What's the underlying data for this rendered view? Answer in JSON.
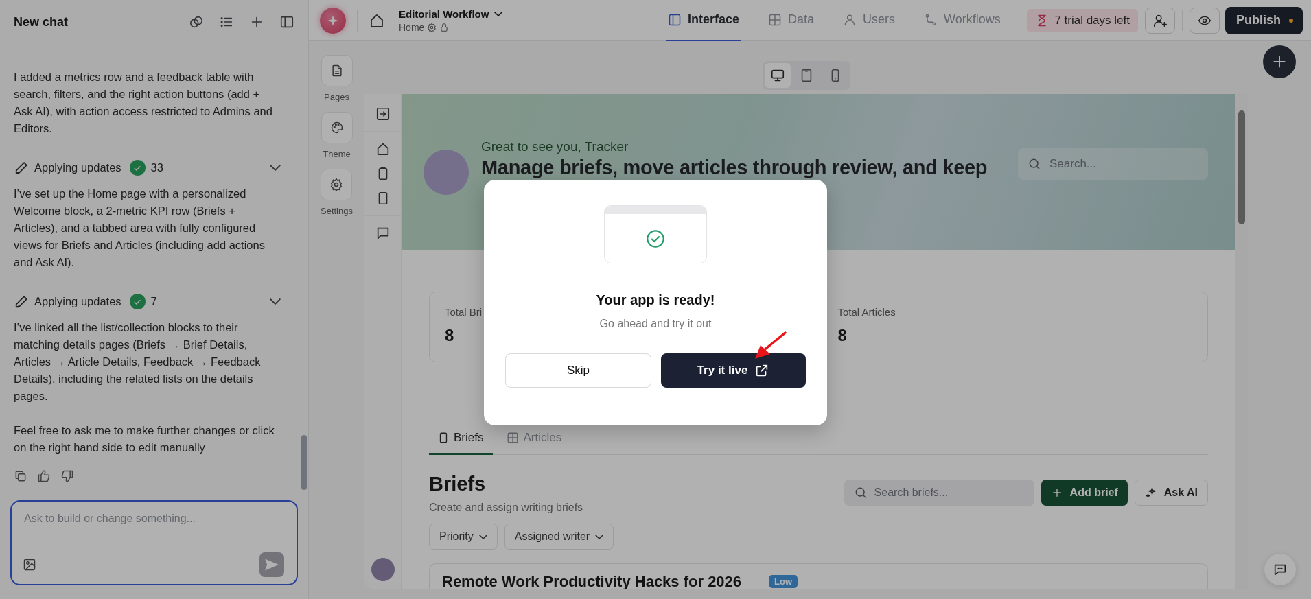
{
  "chat": {
    "title": "New chat",
    "messages": [
      {
        "kind": "text",
        "text": "I added a metrics row and a feedback table with search, filters, and the right action buttons (add + Ask AI), with action access restricted to Admins and Editors."
      },
      {
        "kind": "update",
        "label": "Applying updates",
        "count": "33"
      },
      {
        "kind": "text",
        "text": "I’ve set up the Home page with a personalized Welcome block, a 2-metric KPI row (Briefs + Articles), and a tabbed area with fully configured views for Briefs and Articles (including add actions and Ask AI)."
      },
      {
        "kind": "update",
        "label": "Applying updates",
        "count": "7"
      },
      {
        "kind": "text",
        "text": "I’ve linked all the list/collection blocks to their matching details pages (Briefs → Brief Details, Articles → Article Details, Feedback → Feedback Details), including the related lists on the details pages."
      },
      {
        "kind": "text",
        "text": "Feel free to ask me to make further changes or click on the right hand side to edit manually"
      }
    ],
    "input": {
      "placeholder": "Ask to build or change something..."
    }
  },
  "topbar": {
    "app_name": "Editorial Workflow",
    "page": "Home",
    "tabs": [
      {
        "label": "Interface",
        "selected": true
      },
      {
        "label": "Data",
        "selected": false
      },
      {
        "label": "Users",
        "selected": false
      },
      {
        "label": "Workflows",
        "selected": false
      }
    ],
    "trial": "7 trial days left",
    "publish": "Publish"
  },
  "rail": [
    "Pages",
    "Theme",
    "Settings"
  ],
  "devices": [
    {
      "selected": true
    },
    {
      "selected": false
    },
    {
      "selected": false
    }
  ],
  "app": {
    "welcome": {
      "greeting": "Great to see you, Tracker",
      "headline": "Manage briefs, move articles through review, and keep",
      "search_placeholder": "Search..."
    },
    "metrics": [
      {
        "label": "Total Bri",
        "value": "8"
      },
      {
        "label": "Total Articles",
        "value": "8"
      }
    ],
    "tabs": [
      {
        "label": "Briefs",
        "selected": true
      },
      {
        "label": "Articles",
        "selected": false
      }
    ],
    "section": {
      "title": "Briefs",
      "subtitle": "Create and assign writing briefs",
      "search_placeholder": "Search briefs...",
      "add_button": "Add brief",
      "ai_button": "Ask AI",
      "filters": [
        "Priority",
        "Assigned writer"
      ]
    },
    "rows": [
      {
        "title": "Remote Work Productivity Hacks for 2026",
        "priority": "Low"
      }
    ]
  },
  "modal": {
    "title": "Your app is ready!",
    "subtitle": "Go ahead and try it out",
    "buttons": [
      {
        "label": "Skip",
        "kind": "secondary"
      },
      {
        "label": "Try it live",
        "kind": "primary"
      }
    ]
  }
}
